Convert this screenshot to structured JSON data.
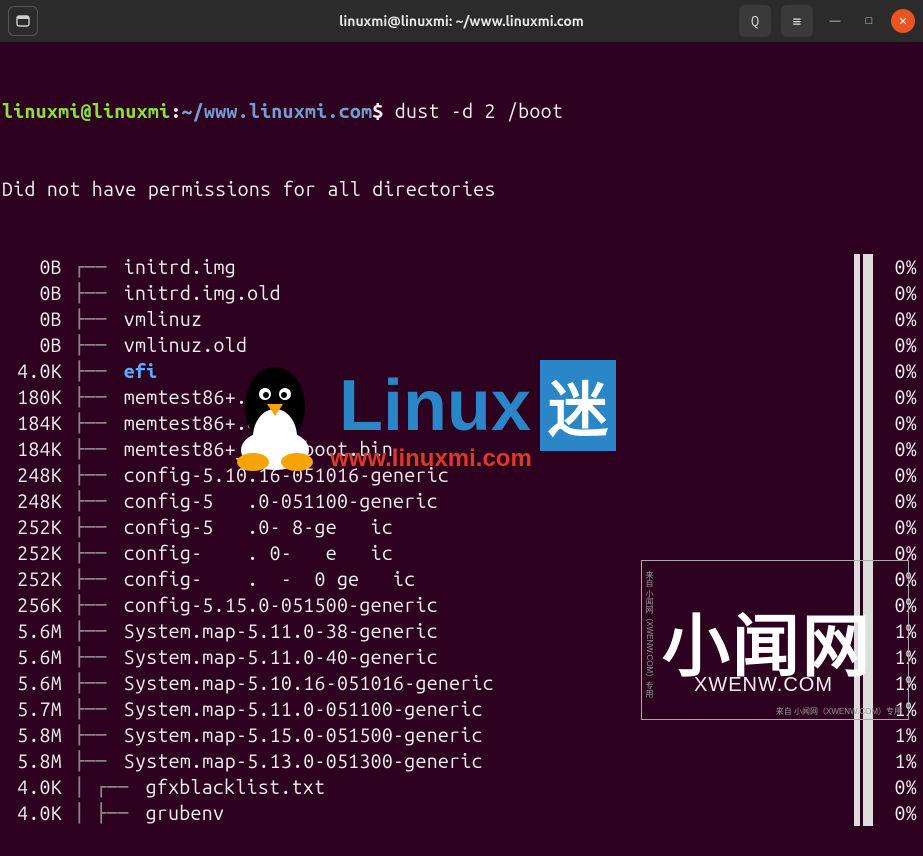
{
  "window": {
    "title": "linuxmi@linuxmi: ~/www.linuxmi.com"
  },
  "prompt": {
    "user": "linuxmi@linuxmi",
    "path": "~/www.linuxmi.com",
    "command": "dust -d 2 /boot"
  },
  "warning": "Did not have permissions for all directories",
  "rows": [
    {
      "size": "0B",
      "tree": "┌── ",
      "name": "initrd.img",
      "dir": false,
      "pct": "0%",
      "indent": 0
    },
    {
      "size": "0B",
      "tree": "├── ",
      "name": "initrd.img.old",
      "dir": false,
      "pct": "0%",
      "indent": 0
    },
    {
      "size": "0B",
      "tree": "├── ",
      "name": "vmlinuz",
      "dir": false,
      "pct": "0%",
      "indent": 0
    },
    {
      "size": "0B",
      "tree": "├── ",
      "name": "vmlinuz.old",
      "dir": false,
      "pct": "0%",
      "indent": 0
    },
    {
      "size": "4.0K",
      "tree": "├── ",
      "name": "efi",
      "dir": true,
      "pct": "0%",
      "indent": 0
    },
    {
      "size": "180K",
      "tree": "├── ",
      "name": "memtest86+.bin",
      "dir": false,
      "pct": "0%",
      "indent": 0
    },
    {
      "size": "184K",
      "tree": "├── ",
      "name": "memtest86+.elf",
      "dir": false,
      "pct": "0%",
      "indent": 0
    },
    {
      "size": "184K",
      "tree": "├── ",
      "name": "memtest86+_multiboot.bin",
      "dir": false,
      "pct": "0%",
      "indent": 0
    },
    {
      "size": "248K",
      "tree": "├── ",
      "name": "config-5.10.16-051016-generic",
      "dir": false,
      "pct": "0%",
      "indent": 0
    },
    {
      "size": "248K",
      "tree": "├── ",
      "name": "config-5   .0-051100-generic",
      "dir": false,
      "pct": "0%",
      "indent": 0
    },
    {
      "size": "252K",
      "tree": "├── ",
      "name": "config-5   .0- 8-ge   ic",
      "dir": false,
      "pct": "0%",
      "indent": 0
    },
    {
      "size": "252K",
      "tree": "├── ",
      "name": "config-    . 0-   e   ic",
      "dir": false,
      "pct": "0%",
      "indent": 0
    },
    {
      "size": "252K",
      "tree": "├── ",
      "name": "config-    .  -  0 ge   ic",
      "dir": false,
      "pct": "0%",
      "indent": 0
    },
    {
      "size": "256K",
      "tree": "├── ",
      "name": "config-5.15.0-051500-generic",
      "dir": false,
      "pct": "0%",
      "indent": 0
    },
    {
      "size": "5.6M",
      "tree": "├── ",
      "name": "System.map-5.11.0-38-generic",
      "dir": false,
      "pct": "1%",
      "indent": 0
    },
    {
      "size": "5.6M",
      "tree": "├── ",
      "name": "System.map-5.11.0-40-generic",
      "dir": false,
      "pct": "1%",
      "indent": 0
    },
    {
      "size": "5.6M",
      "tree": "├── ",
      "name": "System.map-5.10.16-051016-generic",
      "dir": false,
      "pct": "1%",
      "indent": 0
    },
    {
      "size": "5.7M",
      "tree": "├── ",
      "name": "System.map-5.11.0-051100-generic",
      "dir": false,
      "pct": "1%",
      "indent": 0
    },
    {
      "size": "5.8M",
      "tree": "├── ",
      "name": "System.map-5.15.0-051500-generic",
      "dir": false,
      "pct": "1%",
      "indent": 0
    },
    {
      "size": "5.8M",
      "tree": "├── ",
      "name": "System.map-5.13.0-051300-generic",
      "dir": false,
      "pct": "1%",
      "indent": 0
    },
    {
      "size": "4.0K",
      "tree": "│ ┌── ",
      "name": "gfxblacklist.txt",
      "dir": false,
      "pct": "0%",
      "indent": 1
    },
    {
      "size": "4.0K",
      "tree": "│ ├── ",
      "name": "grubenv",
      "dir": false,
      "pct": "0%",
      "indent": 1
    }
  ],
  "icons": {
    "terminal": "⌑",
    "search": "Q",
    "menu": "≡",
    "minimize": "—",
    "maximize": "□",
    "close": "✕"
  },
  "watermark": {
    "brand": "Linux",
    "mi": "迷",
    "url": "www.linuxmi.com",
    "cn": "小闻网",
    "en": "XWENW.COM",
    "credit": "来自 小闻网（XWENW.COM）专用"
  }
}
